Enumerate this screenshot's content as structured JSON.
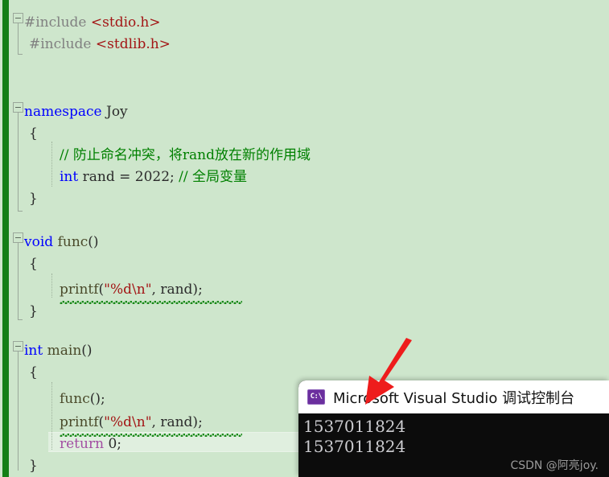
{
  "editor": {
    "background_color": "#cee6cc",
    "change_bar_color": "#137f16",
    "current_line": 20,
    "lines": [
      {
        "n": 1,
        "segments": [
          {
            "t": "#include ",
            "c": "pre"
          },
          {
            "t": "<stdio.h>",
            "c": "str"
          }
        ]
      },
      {
        "n": 2,
        "segments": [
          {
            "t": "#include ",
            "c": "pre"
          },
          {
            "t": "<stdlib.h>",
            "c": "str"
          }
        ]
      },
      {
        "n": 3,
        "segments": []
      },
      {
        "n": 4,
        "segments": []
      },
      {
        "n": 5,
        "segments": [
          {
            "t": "namespace",
            "c": "kw"
          },
          {
            "t": " Joy",
            "c": "plain"
          }
        ]
      },
      {
        "n": 6,
        "segments": [
          {
            "t": "{",
            "c": "plain"
          }
        ]
      },
      {
        "n": 7,
        "segments": [
          {
            "t": "// 防止命名冲突，将rand放在新的作用域",
            "c": "cmt"
          }
        ]
      },
      {
        "n": 8,
        "segments": [
          {
            "t": "int",
            "c": "kw"
          },
          {
            "t": " rand = 2022; ",
            "c": "plain"
          },
          {
            "t": "// 全局变量",
            "c": "cmt"
          }
        ]
      },
      {
        "n": 9,
        "segments": [
          {
            "t": "}",
            "c": "plain"
          }
        ]
      },
      {
        "n": 10,
        "segments": []
      },
      {
        "n": 11,
        "segments": []
      },
      {
        "n": 12,
        "segments": [
          {
            "t": "void",
            "c": "kw"
          },
          {
            "t": " ",
            "c": "plain"
          },
          {
            "t": "func",
            "c": "fn"
          },
          {
            "t": "()",
            "c": "plain"
          }
        ]
      },
      {
        "n": 13,
        "segments": [
          {
            "t": "{",
            "c": "plain"
          }
        ]
      },
      {
        "n": 14,
        "segments": [
          {
            "t": "printf",
            "c": "fn"
          },
          {
            "t": "(",
            "c": "plain"
          },
          {
            "t": "\"%d\\n\"",
            "c": "str"
          },
          {
            "t": ", rand)",
            "c": "plain"
          },
          {
            "t": ";",
            "c": "plain"
          }
        ]
      },
      {
        "n": 15,
        "segments": [
          {
            "t": "}",
            "c": "plain"
          }
        ]
      },
      {
        "n": 16,
        "segments": []
      },
      {
        "n": 17,
        "segments": []
      },
      {
        "n": 18,
        "segments": [
          {
            "t": "int",
            "c": "kw"
          },
          {
            "t": " ",
            "c": "plain"
          },
          {
            "t": "main",
            "c": "fn"
          },
          {
            "t": "()",
            "c": "plain"
          }
        ]
      },
      {
        "n": 19,
        "segments": [
          {
            "t": "{",
            "c": "plain"
          }
        ]
      },
      {
        "n": 20,
        "segments": [
          {
            "t": "func",
            "c": "fn"
          },
          {
            "t": "();",
            "c": "plain"
          }
        ]
      },
      {
        "n": 21,
        "segments": [
          {
            "t": "printf",
            "c": "fn"
          },
          {
            "t": "(",
            "c": "plain"
          },
          {
            "t": "\"%d\\n\"",
            "c": "str"
          },
          {
            "t": ", rand)",
            "c": "plain"
          },
          {
            "t": ";",
            "c": "plain"
          }
        ]
      },
      {
        "n": 22,
        "segments": [
          {
            "t": "return",
            "c": "kwp"
          },
          {
            "t": " 0;",
            "c": "plain"
          }
        ]
      },
      {
        "n": 23,
        "segments": [
          {
            "t": "}",
            "c": "plain"
          }
        ]
      }
    ]
  },
  "console": {
    "icon": "console-icon",
    "icon_glyph": "C:\\",
    "title": "Microsoft Visual Studio 调试控制台",
    "output": [
      "1537011824",
      "1537011824"
    ],
    "watermark": "CSDN @阿亮joy.",
    "background_color": "#0c0c0c",
    "title_background_color": "#ffffff"
  },
  "annotation": {
    "arrow_color": "#ee1c1c",
    "arrow_name": "red-pointer-arrow"
  }
}
